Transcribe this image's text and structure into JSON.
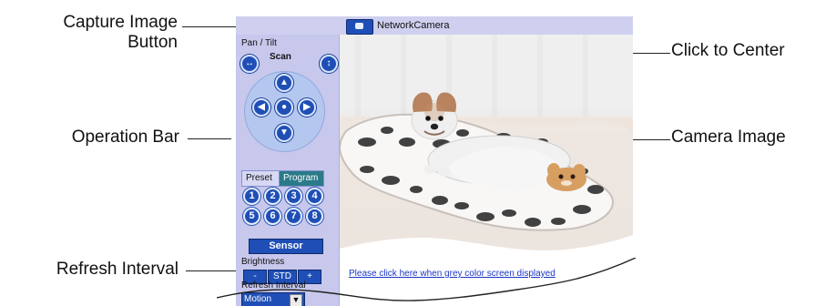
{
  "callouts": {
    "capture_button_line1": "Capture Image",
    "capture_button_line2": "Button",
    "operation_bar": "Operation Bar",
    "refresh_interval": "Refresh Interval",
    "click_to_center": "Click to Center",
    "camera_image": "Camera Image"
  },
  "window": {
    "title": "NetworkCamera"
  },
  "panel": {
    "pan_tilt_label": "Pan / Tilt",
    "scan_label": "Scan",
    "tabs": [
      "Preset",
      "Program"
    ],
    "preset_numbers": [
      "1",
      "2",
      "3",
      "4",
      "5",
      "6",
      "7",
      "8"
    ],
    "sensor_label": "Sensor",
    "brightness_label": "Brightness",
    "brightness_buttons": [
      "-",
      "STD",
      "+"
    ],
    "refresh_interval_label": "Refresh Interval",
    "refresh_value": "Motion"
  },
  "main": {
    "grey_screen_link": "Please click here when grey color screen displayed"
  },
  "colors": {
    "title_bar": "#cfd0ef",
    "panel_bg": "#c7c8ec",
    "accent_blue": "#1f4fb6",
    "program_tab": "#2a7a89"
  },
  "icons": {
    "capture": "camera-icon",
    "scan_left": "scan-left-icon",
    "scan_right": "scan-right-icon",
    "dpad_up": "arrow-up-icon",
    "dpad_down": "arrow-down-icon",
    "dpad_left": "arrow-left-icon",
    "dpad_right": "arrow-right-icon",
    "dpad_home": "home-icon"
  }
}
